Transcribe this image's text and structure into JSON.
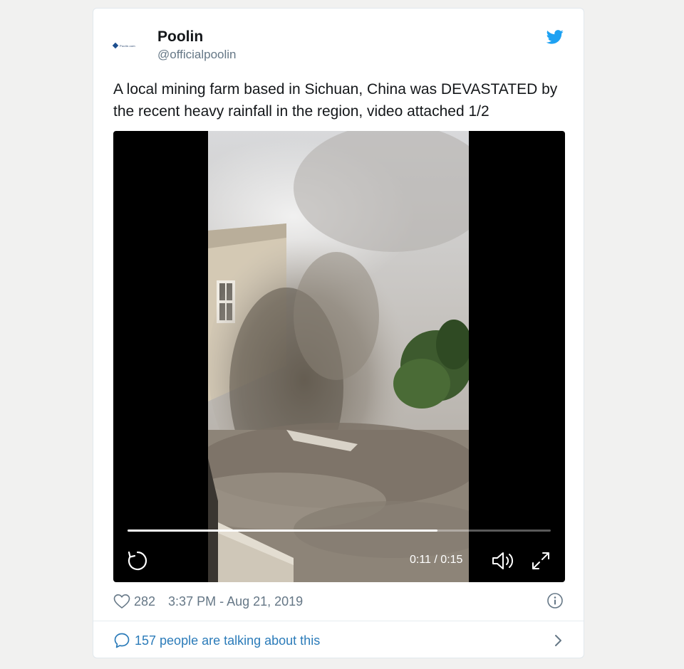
{
  "tweet": {
    "author": {
      "display_name": "Poolin",
      "handle": "@officialpoolin",
      "avatar_text": "Poolin.com"
    },
    "text": "A local mining farm based in Sichuan, China was DEVASTATED by the recent heavy rainfall in the region, video attached 1/2",
    "like_count": "282",
    "timestamp": "3:37 PM - Aug 21, 2019",
    "talking_text": "157 people are talking about this"
  },
  "video": {
    "time_display": "0:11 / 0:15",
    "progress": 0.733
  },
  "colors": {
    "twitter_blue": "#1da1f2",
    "link_blue": "#2b7bb9",
    "secondary_text": "#657786",
    "primary_text": "#14171a"
  },
  "icons": {
    "brand": "twitter-bird-icon",
    "replay": "replay-icon",
    "volume": "volume-icon",
    "fullscreen": "fullscreen-icon",
    "like": "heart-icon",
    "info": "info-icon",
    "conversation": "speech-bubble-icon",
    "navigate": "chevron-right-icon"
  }
}
